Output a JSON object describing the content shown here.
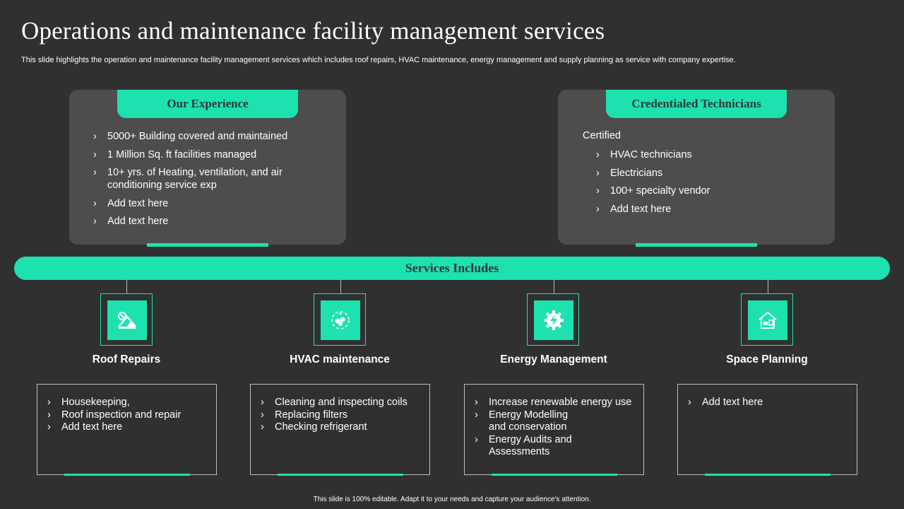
{
  "title": "Operations and maintenance facility management services",
  "subtitle": "This slide highlights the operation and maintenance facility management services which includes roof repairs, HVAC maintenance, energy management and supply planning as service with company expertise.",
  "bullet_char": "›",
  "experience": {
    "heading": "Our Experience",
    "items": [
      "5000+ Building covered and maintained",
      "1 Million  Sq. ft facilities managed",
      "10+ yrs. of Heating,  ventilation,  and air conditioning service exp",
      "Add text here",
      "Add text here"
    ]
  },
  "technicians": {
    "heading": "Credentialed Technicians",
    "lead": "Certified",
    "items": [
      "HVAC technicians",
      "Electricians",
      "100+ specialty vendor",
      "Add text here"
    ]
  },
  "band_label": "Services Includes",
  "services": [
    {
      "title": "Roof Repairs",
      "icon": "roof-repair-icon",
      "items": [
        "Housekeeping,",
        "Roof inspection and repair",
        "Add text here"
      ]
    },
    {
      "title": "HVAC maintenance",
      "icon": "hvac-icon",
      "items": [
        "Cleaning and inspecting coils",
        "Replacing filters",
        "Checking refrigerant"
      ]
    },
    {
      "title": "Energy Management",
      "icon": "energy-gear-icon",
      "items": [
        "Increase renewable energy use",
        "Energy Modelling and conservation",
        "Energy Audits and Assessments"
      ]
    },
    {
      "title": "Space Planning",
      "icon": "house-planning-icon",
      "items": [
        "Add text here"
      ]
    }
  ],
  "footer": "This slide is 100% editable.  Adapt it to your needs and capture your audience's attention.",
  "colors": {
    "accent": "#1de2b0",
    "background": "#303030",
    "panel": "#4d4d4d"
  }
}
